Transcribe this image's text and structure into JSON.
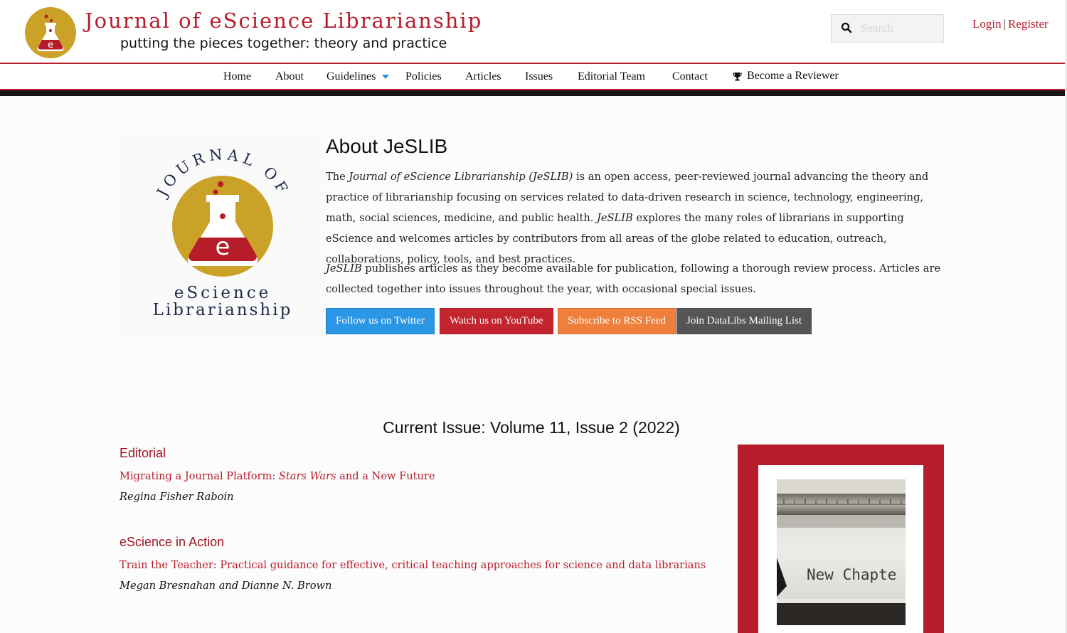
{
  "header": {
    "title": "Journal of eScience Librarianship",
    "tagline": "putting the pieces together: theory and practice",
    "search_placeholder": "Search",
    "login": "Login",
    "separator": "|",
    "register": "Register"
  },
  "nav": {
    "items": [
      "Home",
      "About",
      "Guidelines",
      "Policies",
      "Articles",
      "Issues",
      "Editorial Team",
      "Contact",
      "Become a Reviewer"
    ],
    "dropdown_color": "#2a8fd6"
  },
  "about": {
    "title": "About JeSLIB",
    "logo_text_top": "JOURNAL OF",
    "logo_text_mid": "eScience",
    "logo_text_bottom": "Librarianship",
    "p1_before": "The ",
    "p1_journal": "Journal of eScience Librarianship (JeSLIB)",
    "p1_middle": " is an open access, peer-reviewed journal advancing the theory and practice of librarianship focusing on services related to data-driven research in science, technology, engineering, math, social sciences, medicine, and public health. ",
    "p1_abbr": "JeSLIB",
    "p1_after": " explores the many roles of librarians in supporting eScience and welcomes articles by contributors from all areas of the globe related to education, outreach, collaborations, policy, tools, and best practices.",
    "p2_abbr": "JeSLIB",
    "p2_after": " publishes articles as they become available for publication, following a thorough review process. Articles are collected together into issues throughout the year, with occasional special issues.",
    "buttons": [
      {
        "label": "Follow us on Twitter",
        "color": "#2a96e6"
      },
      {
        "label": "Watch us on YouTube",
        "color": "#c4242e"
      },
      {
        "label": "Subscribe to RSS Feed",
        "color": "#ef7f3a"
      },
      {
        "label": "Join DataLibs Mailing List",
        "color": "#555555"
      }
    ]
  },
  "current_issue": {
    "heading": "Current Issue: Volume 11, Issue 2 (2022)",
    "sections": [
      {
        "title": "Editorial",
        "article_before": "Migrating a Journal Platform: ",
        "article_em": "Stars Wars",
        "article_after": " and a New Future",
        "authors": "Regina Fisher Raboin"
      },
      {
        "title": "eScience in Action",
        "article": "Train the Teacher: Practical guidance for effective, critical teaching approaches for science and data librarians",
        "authors": "Megan Bresnahan and Dianne N. Brown"
      }
    ],
    "cover_text": "New Chapte"
  },
  "colors": {
    "brand_red": "#b71c2b",
    "gold": "#c9a227",
    "navy": "#1e2a4a"
  }
}
